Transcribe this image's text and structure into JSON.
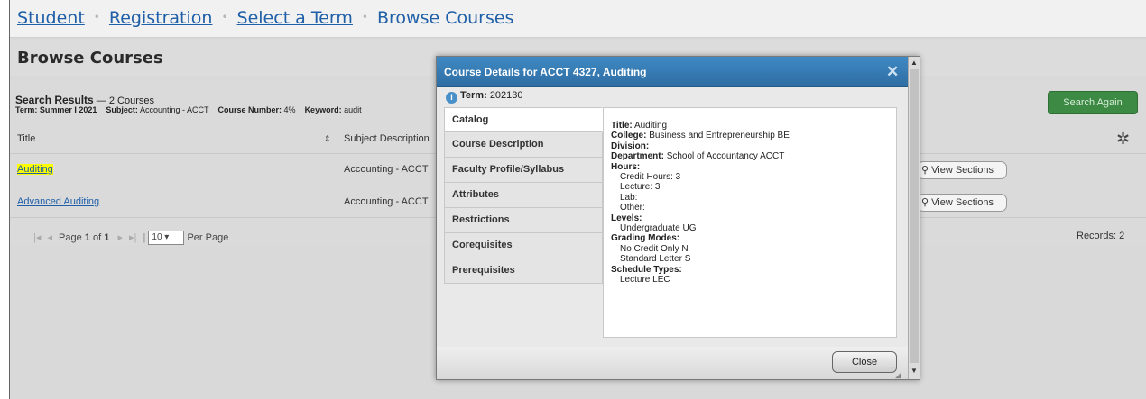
{
  "breadcrumb": {
    "student": "Student",
    "registration": "Registration",
    "select_term": "Select a Term",
    "current": "Browse Courses",
    "separator": "•"
  },
  "page": {
    "title": "Browse Courses"
  },
  "search": {
    "results_label": "Search Results",
    "results_count": "— 2 Courses",
    "term_label": "Term:",
    "term_value": "Summer I 2021",
    "subject_label": "Subject:",
    "subject_value": "Accounting - ACCT",
    "number_label": "Course Number:",
    "number_value": "4%",
    "keyword_label": "Keyword:",
    "keyword_value": "audit",
    "search_again": "Search Again"
  },
  "table": {
    "columns": {
      "title": "Title",
      "subject": "Subject Description"
    },
    "sort_icon": "⇕",
    "rows": [
      {
        "title": "Auditing",
        "subject": "Accounting - ACCT",
        "view": "View Sections"
      },
      {
        "title": "Advanced Auditing",
        "subject": "Accounting - ACCT",
        "view": "View Sections"
      }
    ],
    "pager": {
      "page_label": "Page",
      "page": "1",
      "of_label": "of",
      "total": "1",
      "per_page": "10",
      "per_page_label": "Per Page"
    },
    "records": "Records: 2"
  },
  "modal": {
    "title": "Course Details for ACCT 4327, Auditing",
    "term_label": "Term:",
    "term_value": "202130",
    "tabs": [
      "Catalog",
      "Course Description",
      "Faculty Profile/Syllabus",
      "Attributes",
      "Restrictions",
      "Corequisites",
      "Prerequisites"
    ],
    "details": {
      "title_label": "Title:",
      "title_value": "Auditing",
      "college_label": "College:",
      "college_value": "Business and Entrepreneurship BE",
      "division_label": "Division:",
      "department_label": "Department:",
      "department_value": "School of Accountancy ACCT",
      "hours_label": "Hours:",
      "credit_hours": "Credit Hours: 3",
      "lecture": "Lecture: 3",
      "lab": "Lab:",
      "other": "Other:",
      "levels_label": "Levels:",
      "levels_value": "Undergraduate UG",
      "grading_label": "Grading Modes:",
      "grading_1": "No Credit Only N",
      "grading_2": "Standard Letter S",
      "schedule_label": "Schedule Types:",
      "schedule_value": "Lecture LEC"
    },
    "close": "Close"
  },
  "colors": {
    "link": "#1f5fa8",
    "modal_header": "#3f89c4",
    "search_again_bg": "#3c8a44",
    "highlight": "#ffff00"
  },
  "icons": [
    "info-icon",
    "close-icon",
    "gear-icon",
    "search-icon",
    "sort-icon",
    "first-page-icon",
    "prev-page-icon",
    "next-page-icon",
    "last-page-icon",
    "resize-grip-icon"
  ]
}
